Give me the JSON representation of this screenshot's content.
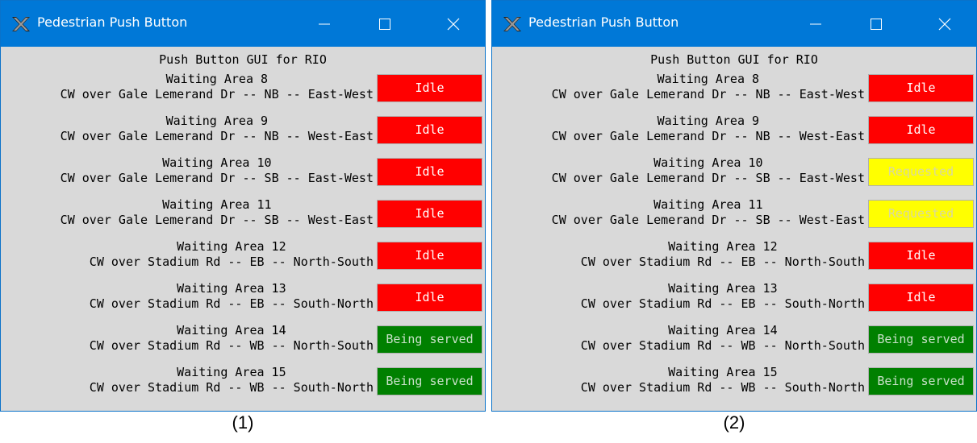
{
  "colors": {
    "titlebar": "#0078d7",
    "window_bg": "#d9d9d9",
    "idle": "#ff0000",
    "requested": "#ffff00",
    "being_served": "#008000"
  },
  "panels": [
    {
      "window_title": "Pedestrian Push Button",
      "heading": "Push Button GUI for RIO",
      "caption": "(1)",
      "rows": [
        {
          "area": "Waiting Area 8",
          "crosswalk": "CW over Gale Lemerand Dr -- NB -- East-West",
          "status": "Idle",
          "state": "idle"
        },
        {
          "area": "Waiting Area 9",
          "crosswalk": "CW over Gale Lemerand Dr -- NB -- West-East",
          "status": "Idle",
          "state": "idle"
        },
        {
          "area": "Waiting Area 10",
          "crosswalk": "CW over Gale Lemerand Dr -- SB -- East-West",
          "status": "Idle",
          "state": "idle"
        },
        {
          "area": "Waiting Area 11",
          "crosswalk": "CW over Gale Lemerand Dr -- SB -- West-East",
          "status": "Idle",
          "state": "idle"
        },
        {
          "area": "Waiting Area 12",
          "crosswalk": "CW over Stadium Rd -- EB -- North-South",
          "status": "Idle",
          "state": "idle"
        },
        {
          "area": "Waiting Area 13",
          "crosswalk": "CW over Stadium Rd -- EB -- South-North",
          "status": "Idle",
          "state": "idle"
        },
        {
          "area": "Waiting Area 14",
          "crosswalk": "CW over Stadium Rd -- WB -- North-South",
          "status": "Being served",
          "state": "served"
        },
        {
          "area": "Waiting Area 15",
          "crosswalk": "CW over Stadium Rd -- WB -- South-North",
          "status": "Being served",
          "state": "served"
        }
      ]
    },
    {
      "window_title": "Pedestrian Push Button",
      "heading": "Push Button GUI for RIO",
      "caption": "(2)",
      "rows": [
        {
          "area": "Waiting Area 8",
          "crosswalk": "CW over Gale Lemerand Dr -- NB -- East-West",
          "status": "Idle",
          "state": "idle"
        },
        {
          "area": "Waiting Area 9",
          "crosswalk": "CW over Gale Lemerand Dr -- NB -- West-East",
          "status": "Idle",
          "state": "idle"
        },
        {
          "area": "Waiting Area 10",
          "crosswalk": "CW over Gale Lemerand Dr -- SB -- East-West",
          "status": "Requested",
          "state": "requested"
        },
        {
          "area": "Waiting Area 11",
          "crosswalk": "CW over Gale Lemerand Dr -- SB -- West-East",
          "status": "Requested",
          "state": "requested"
        },
        {
          "area": "Waiting Area 12",
          "crosswalk": "CW over Stadium Rd -- EB -- North-South",
          "status": "Idle",
          "state": "idle"
        },
        {
          "area": "Waiting Area 13",
          "crosswalk": "CW over Stadium Rd -- EB -- South-North",
          "status": "Idle",
          "state": "idle"
        },
        {
          "area": "Waiting Area 14",
          "crosswalk": "CW over Stadium Rd -- WB -- North-South",
          "status": "Being served",
          "state": "served"
        },
        {
          "area": "Waiting Area 15",
          "crosswalk": "CW over Stadium Rd -- WB -- South-North",
          "status": "Being served",
          "state": "served"
        }
      ]
    }
  ]
}
